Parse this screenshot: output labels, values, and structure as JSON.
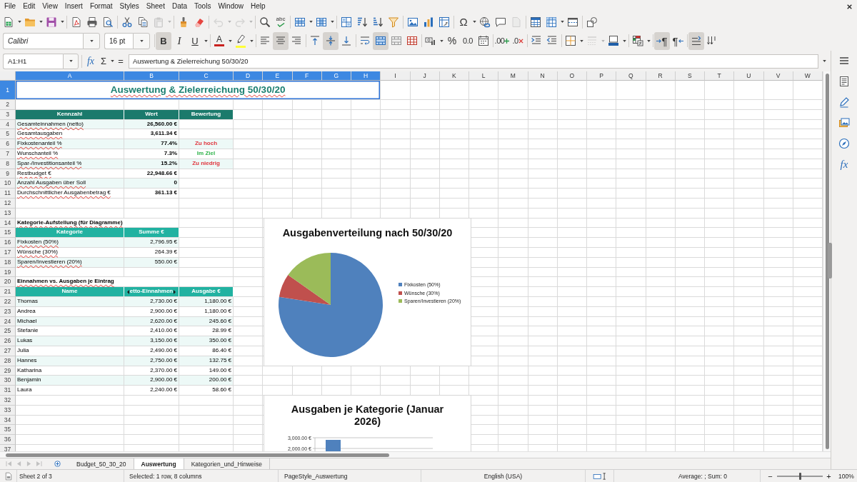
{
  "menu_bar": [
    "File",
    "Edit",
    "View",
    "Insert",
    "Format",
    "Styles",
    "Sheet",
    "Data",
    "Tools",
    "Window",
    "Help"
  ],
  "standard_toolbar": {
    "paste": {
      "disabled": true
    },
    "undo": {
      "disabled": true
    },
    "redo": {
      "disabled": true
    },
    "spelling": {
      "label": "abc"
    },
    "special_character": {
      "label": "Ω"
    },
    "headers_footers": {
      "disabled": true
    }
  },
  "formatting_toolbar": {
    "font_name": "Calibri",
    "font_size": "16 pt",
    "bold": {
      "label": "B",
      "on": true
    },
    "italic": {
      "label": "I",
      "on": false
    },
    "underline": {
      "label": "U",
      "on": false
    },
    "font_color": {
      "label": "A"
    },
    "align_left": {
      "on": false
    },
    "align_center": {
      "on": true
    },
    "align_right": {
      "on": false
    },
    "align_top": {
      "on": false
    },
    "align_middle": {
      "on": true
    },
    "align_bottom": {
      "on": false
    },
    "wrap_text": {
      "on": false
    },
    "merge_center": {
      "on": true
    },
    "percent": {
      "label": "%"
    },
    "standard_format": {
      "label": "0.0"
    },
    "add_decimal": {
      "label": ".00"
    },
    "delete_decimal": {
      "label": ".0"
    },
    "border_style": {
      "disabled": true
    },
    "left_to_right": {
      "label": "¶",
      "on": true
    },
    "right_to_left": {
      "label": "¶",
      "on": false
    },
    "text_horizontal": {
      "on": true
    },
    "text_vertical": {
      "on": false
    }
  },
  "formula_bar": {
    "name_box": "A1:H1",
    "function_glyph": "fx",
    "sum_glyph": "Σ",
    "equals_glyph": "=",
    "content": "Auswertung & Zielerreichung 50/30/20"
  },
  "sidebar": {
    "functions_glyph": "fx"
  },
  "sheet": {
    "columns": [
      {
        "label": "A",
        "selected": true
      },
      {
        "label": "B",
        "selected": true
      },
      {
        "label": "C",
        "selected": true
      },
      {
        "label": "D",
        "selected": true
      },
      {
        "label": "E",
        "selected": true
      },
      {
        "label": "F",
        "selected": true
      },
      {
        "label": "G",
        "selected": true
      },
      {
        "label": "H",
        "selected": true
      },
      {
        "label": "I",
        "selected": false
      },
      {
        "label": "J",
        "selected": false
      },
      {
        "label": "K",
        "selected": false
      },
      {
        "label": "L",
        "selected": false
      },
      {
        "label": "M",
        "selected": false
      },
      {
        "label": "N",
        "selected": false
      },
      {
        "label": "O",
        "selected": false
      },
      {
        "label": "P",
        "selected": false
      },
      {
        "label": "Q",
        "selected": false
      },
      {
        "label": "R",
        "selected": false
      },
      {
        "label": "S",
        "selected": false
      },
      {
        "label": "T",
        "selected": false
      },
      {
        "label": "U",
        "selected": false
      },
      {
        "label": "V",
        "selected": false
      },
      {
        "label": "W",
        "selected": false
      }
    ],
    "rows": [
      {
        "label": "1",
        "selected": true,
        "kind": "title",
        "cells": [
          {
            "text": "Auswertung & Zielerreichung 50/30/20",
            "spelling_marked": true
          }
        ]
      },
      {
        "label": "2",
        "selected": false
      },
      {
        "label": "3",
        "selected": false,
        "kind": "header",
        "color": "#1b7a6c",
        "cells": [
          {
            "text": "Kennzahl"
          },
          {
            "text": "Wert"
          },
          {
            "text": "Bewertung"
          }
        ]
      },
      {
        "label": "4",
        "selected": false,
        "kind": "metric",
        "shaded": true,
        "cells": [
          {
            "text": "Gesamteinnahmen (netto)",
            "spelling_marked": true
          },
          {
            "text": "26,560.00 €"
          }
        ]
      },
      {
        "label": "5",
        "selected": false,
        "kind": "metric",
        "shaded": false,
        "cells": [
          {
            "text": "Gesamtausgaben",
            "spelling_marked": true
          },
          {
            "text": "3,611.34 €"
          }
        ]
      },
      {
        "label": "6",
        "selected": false,
        "kind": "metric",
        "shaded": true,
        "cells": [
          {
            "text": "Fixkostenanteil %",
            "spelling_marked": true
          },
          {
            "text": "77.4%"
          },
          {
            "text": "Zu hoch",
            "color": "#e0343c"
          }
        ]
      },
      {
        "label": "7",
        "selected": false,
        "kind": "metric",
        "shaded": false,
        "cells": [
          {
            "text": "Wunschanteil %",
            "spelling_marked": true
          },
          {
            "text": "7.3%"
          },
          {
            "text": "Im Ziel",
            "color": "#2fb34a"
          }
        ]
      },
      {
        "label": "8",
        "selected": false,
        "kind": "metric",
        "shaded": true,
        "cells": [
          {
            "text": "Spar-/Investitionsanteil %",
            "spelling_marked": true
          },
          {
            "text": "15.2%"
          },
          {
            "text": "Zu niedrig",
            "color": "#e0343c"
          }
        ]
      },
      {
        "label": "9",
        "selected": false,
        "kind": "metric",
        "shaded": false,
        "cells": [
          {
            "text": "Restbudget €",
            "spelling_marked": true
          },
          {
            "text": "22,948.66 €"
          }
        ]
      },
      {
        "label": "10",
        "selected": false,
        "kind": "metric",
        "shaded": true,
        "cells": [
          {
            "text": "Anzahl Ausgaben über Soll",
            "spelling_marked": true
          },
          {
            "text": "0"
          }
        ]
      },
      {
        "label": "11",
        "selected": false,
        "kind": "metric",
        "shaded": false,
        "cells": [
          {
            "text": "Durchschnittlicher Ausgabenbetrag €",
            "spelling_marked": true
          },
          {
            "text": "361.13 €"
          }
        ]
      },
      {
        "label": "12",
        "selected": false
      },
      {
        "label": "13",
        "selected": false
      },
      {
        "label": "14",
        "selected": false,
        "kind": "section",
        "cells": [
          {
            "text": "Kategorie-Aufstellung (für Diagramme)",
            "spelling_marked": true
          }
        ]
      },
      {
        "label": "15",
        "selected": false,
        "kind": "header",
        "color": "#21b2a1",
        "cells": [
          {
            "text": "Kategorie"
          },
          {
            "text": "Summe €"
          }
        ]
      },
      {
        "label": "16",
        "selected": false,
        "kind": "data",
        "shaded": true,
        "cells": [
          {
            "text": "Fixkosten (50%)",
            "spelling_marked": true
          },
          {
            "text": "2,796.95 €"
          }
        ]
      },
      {
        "label": "17",
        "selected": false,
        "kind": "data",
        "shaded": false,
        "cells": [
          {
            "text": "Wünsche (30%)",
            "spelling_marked": true
          },
          {
            "text": "264.39 €"
          }
        ]
      },
      {
        "label": "18",
        "selected": false,
        "kind": "data",
        "shaded": true,
        "cells": [
          {
            "text": "Sparen/Investieren (20%)",
            "spelling_marked": true
          },
          {
            "text": "550.00 €"
          }
        ]
      },
      {
        "label": "19",
        "selected": false
      },
      {
        "label": "20",
        "selected": false,
        "kind": "section",
        "cells": [
          {
            "text": "Einnahmen vs. Ausgaben je Eintrag",
            "spelling_marked": true
          }
        ]
      },
      {
        "label": "21",
        "selected": false,
        "kind": "header",
        "color": "#21b2a1",
        "cells": [
          {
            "text": "Name"
          },
          {
            "text": "etto-Einnahmen",
            "clipped": true
          },
          {
            "text": "Ausgabe €"
          }
        ]
      },
      {
        "label": "22",
        "selected": false,
        "kind": "data",
        "shaded": true,
        "cells": [
          {
            "text": "Thomas"
          },
          {
            "text": "2,730.00 €"
          },
          {
            "text": "1,180.00 €"
          }
        ]
      },
      {
        "label": "23",
        "selected": false,
        "kind": "data",
        "shaded": false,
        "cells": [
          {
            "text": "Andrea"
          },
          {
            "text": "2,900.00 €"
          },
          {
            "text": "1,180.00 €"
          }
        ]
      },
      {
        "label": "24",
        "selected": false,
        "kind": "data",
        "shaded": true,
        "cells": [
          {
            "text": "Michael"
          },
          {
            "text": "2,620.00 €"
          },
          {
            "text": "245.60 €"
          }
        ]
      },
      {
        "label": "25",
        "selected": false,
        "kind": "data",
        "shaded": false,
        "cells": [
          {
            "text": "Stefanie"
          },
          {
            "text": "2,410.00 €"
          },
          {
            "text": "28.99 €"
          }
        ]
      },
      {
        "label": "26",
        "selected": false,
        "kind": "data",
        "shaded": true,
        "cells": [
          {
            "text": "Lukas"
          },
          {
            "text": "3,150.00 €"
          },
          {
            "text": "350.00 €"
          }
        ]
      },
      {
        "label": "27",
        "selected": false,
        "kind": "data",
        "shaded": false,
        "cells": [
          {
            "text": "Julia"
          },
          {
            "text": "2,490.00 €"
          },
          {
            "text": "86.40 €"
          }
        ]
      },
      {
        "label": "28",
        "selected": false,
        "kind": "data",
        "shaded": true,
        "cells": [
          {
            "text": "Hannes"
          },
          {
            "text": "2,750.00 €"
          },
          {
            "text": "132.75 €"
          }
        ]
      },
      {
        "label": "29",
        "selected": false,
        "kind": "data",
        "shaded": false,
        "cells": [
          {
            "text": "Katharina"
          },
          {
            "text": "2,370.00 €"
          },
          {
            "text": "149.00 €"
          }
        ]
      },
      {
        "label": "30",
        "selected": false,
        "kind": "data",
        "shaded": true,
        "cells": [
          {
            "text": "Benjamin"
          },
          {
            "text": "2,900.00 €"
          },
          {
            "text": "200.00 €"
          }
        ]
      },
      {
        "label": "31",
        "selected": false,
        "kind": "data",
        "shaded": false,
        "cells": [
          {
            "text": "Laura"
          },
          {
            "text": "2,240.00 €"
          },
          {
            "text": "58.60 €"
          }
        ]
      },
      {
        "label": "32",
        "selected": false
      },
      {
        "label": "33",
        "selected": false
      },
      {
        "label": "34",
        "selected": false
      },
      {
        "label": "35",
        "selected": false
      },
      {
        "label": "36",
        "selected": false
      },
      {
        "label": "37",
        "selected": false
      }
    ],
    "charts": [
      {
        "chart_data": {
          "type": "pie",
          "title": "Ausgabenverteilung nach 50/30/20",
          "categories": [
            "Fixkosten (50%)",
            "Wünsche (30%)",
            "Sparen/Investieren (20%)"
          ],
          "values": [
            77.45,
            7.32,
            15.23
          ],
          "colors": [
            "#4f81bd",
            "#c0504d",
            "#9bbb59"
          ],
          "legend": "right"
        }
      },
      {
        "chart_data": {
          "type": "bar",
          "title": "Ausgaben je Kategorie (Januar 2026)",
          "ylim": [
            0,
            3000
          ],
          "yticks": [
            {
              "value": 3000,
              "label": "3,000.00 €"
            },
            {
              "value": 2000,
              "label": "2,000.00 €"
            }
          ],
          "values": [
            2800
          ]
        }
      }
    ]
  },
  "sheet_tabs": {
    "navigation_disabled": true,
    "tabs": [
      {
        "label": "Budget_50_30_20",
        "selected": false
      },
      {
        "label": "Auswertung",
        "selected": true
      },
      {
        "label": "Kategorien_und_Hinweise",
        "selected": false
      }
    ]
  },
  "status_bar": {
    "sheet_position": "Sheet 2 of 3",
    "selection": "Selected: 1 row, 8 columns",
    "page_style": "PageStyle_Auswertung",
    "language": "English (USA)",
    "statistics": "Average: ; Sum: 0",
    "zoom": {
      "minus": "−",
      "plus": "+",
      "level": 0.5,
      "reading": "100%"
    }
  }
}
